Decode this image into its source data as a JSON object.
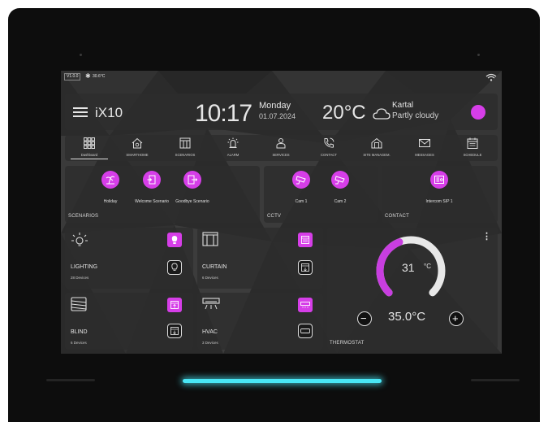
{
  "status_bar": {
    "version": "V1.0.0",
    "temp": "30.6°C"
  },
  "header": {
    "app_name": "iX10",
    "time": "10:17",
    "day": "Monday",
    "date": "01.07.2024",
    "weather_temp": "20°C",
    "location": "Kartal",
    "condition": "Partly cloudy"
  },
  "nav": {
    "items": [
      {
        "label": "Dashboard",
        "icon": "grid-icon"
      },
      {
        "label": "SMARTHOME",
        "icon": "home-icon"
      },
      {
        "label": "SCENARIOS",
        "icon": "scenarios-icon"
      },
      {
        "label": "ALARM",
        "icon": "alarm-icon"
      },
      {
        "label": "SERVICES",
        "icon": "services-icon"
      },
      {
        "label": "CONTACT",
        "icon": "phone-icon"
      },
      {
        "label": "SITE MANAGEM.",
        "icon": "building-icon"
      },
      {
        "label": "MESSAGES",
        "icon": "mail-icon"
      },
      {
        "label": "SCHEDULE",
        "icon": "calendar-icon"
      }
    ]
  },
  "scenarios": {
    "title": "SCENARIOS",
    "items": [
      {
        "label": "Holiday"
      },
      {
        "label": "Welcome Scenario"
      },
      {
        "label": "Goodbye Scenario"
      }
    ]
  },
  "cctv": {
    "title": "CCTV",
    "items": [
      {
        "label": "Cam 1"
      },
      {
        "label": "Cam 2"
      }
    ]
  },
  "contact": {
    "title": "CONTACT",
    "items": [
      {
        "label": "Intercom SIP 1"
      }
    ]
  },
  "lighting": {
    "title": "LIGHTING",
    "count": "28 Devices"
  },
  "curtain": {
    "title": "CURTAIN",
    "count": "6 Devices"
  },
  "blind": {
    "title": "BLIND",
    "count": "6 Devices"
  },
  "hvac": {
    "title": "HVAC",
    "count": "3 Devices"
  },
  "thermostat": {
    "title": "THERMOSTAT",
    "current": "31",
    "unit": "°C",
    "setpoint": "35.0°C",
    "minus": "−",
    "plus": "+",
    "level": 0.42
  },
  "colors": {
    "accent": "#d63ee8",
    "glow": "#49e6f5",
    "background": "#0d0d0d"
  }
}
